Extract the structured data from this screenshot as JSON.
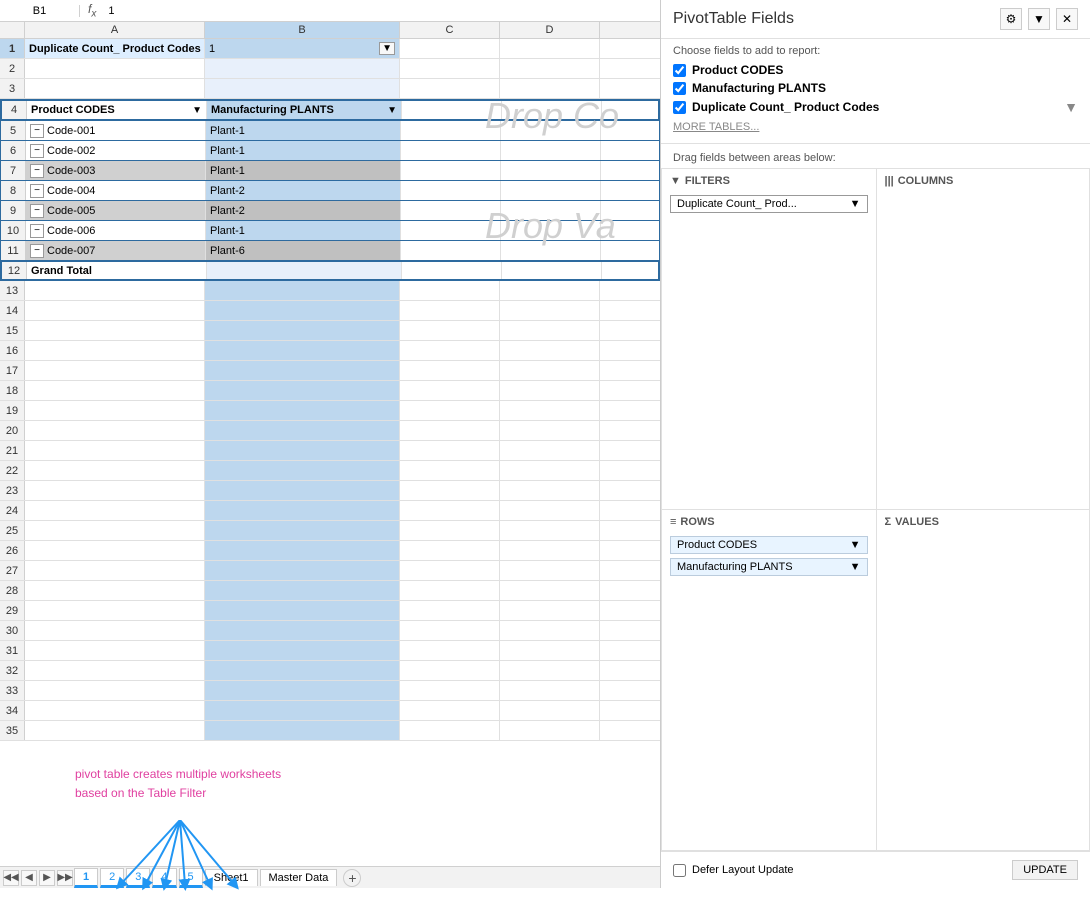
{
  "panel": {
    "title": "PivotTable Fields",
    "chooser_label": "Choose fields to add to report:",
    "fields": [
      {
        "name": "Product CODES",
        "checked": true
      },
      {
        "name": "Manufacturing PLANTS",
        "checked": true
      },
      {
        "name": "Duplicate Count_ Product Codes",
        "checked": true
      }
    ],
    "more_tables": "MORE TABLES...",
    "drag_label": "Drag fields between areas below:",
    "areas": {
      "filters": "FILTERS",
      "columns": "COLUMNS",
      "rows": "ROWS",
      "values": "VALUES"
    },
    "filter_pill": "Duplicate Count_ Prod...",
    "rows_pills": [
      "Product CODES",
      "Manufacturing PLANTS"
    ],
    "defer_label": "Defer Layout Update",
    "update_btn": "UPDATE"
  },
  "spreadsheet": {
    "name_box": "B1",
    "formula": "1",
    "columns": [
      "A",
      "B",
      "C",
      "D"
    ],
    "rows": [
      {
        "num": 1,
        "a": "Duplicate Count_ Product Codes",
        "b": "1",
        "c": "",
        "d": "",
        "filter": true
      },
      {
        "num": 2,
        "a": "",
        "b": "",
        "c": "",
        "d": ""
      },
      {
        "num": 3,
        "a": "",
        "b": "",
        "c": "",
        "d": ""
      },
      {
        "num": 4,
        "a": "Product CODES",
        "b": "Manufacturing PLANTS",
        "c": "",
        "d": "",
        "header": true
      },
      {
        "num": 5,
        "a": "Code-001",
        "b": "Plant-1",
        "c": "",
        "d": "",
        "gray": false
      },
      {
        "num": 6,
        "a": "Code-002",
        "b": "Plant-1",
        "c": "",
        "d": "",
        "gray": false
      },
      {
        "num": 7,
        "a": "Code-003",
        "b": "Plant-1",
        "c": "",
        "d": "",
        "gray": true
      },
      {
        "num": 8,
        "a": "Code-004",
        "b": "Plant-2",
        "c": "",
        "d": "",
        "gray": false
      },
      {
        "num": 9,
        "a": "Code-005",
        "b": "Plant-2",
        "c": "",
        "d": "",
        "gray": true
      },
      {
        "num": 10,
        "a": "Code-006",
        "b": "Plant-1",
        "c": "",
        "d": "",
        "gray": false
      },
      {
        "num": 11,
        "a": "Code-007",
        "b": "Plant-6",
        "c": "",
        "d": "",
        "gray": true
      },
      {
        "num": 12,
        "a": "Grand Total",
        "b": "",
        "c": "",
        "d": ""
      },
      {
        "num": 13,
        "a": "",
        "b": "",
        "c": "",
        "d": ""
      },
      {
        "num": 14,
        "a": "",
        "b": "",
        "c": "",
        "d": ""
      },
      {
        "num": 15,
        "a": "",
        "b": "",
        "c": "",
        "d": ""
      },
      {
        "num": 16,
        "a": "",
        "b": "",
        "c": "",
        "d": ""
      },
      {
        "num": 17,
        "a": "",
        "b": "",
        "c": "",
        "d": ""
      },
      {
        "num": 18,
        "a": "",
        "b": "",
        "c": "",
        "d": ""
      },
      {
        "num": 19,
        "a": "",
        "b": "",
        "c": "",
        "d": ""
      },
      {
        "num": 20,
        "a": "",
        "b": "",
        "c": "",
        "d": ""
      },
      {
        "num": 21,
        "a": "",
        "b": "",
        "c": "",
        "d": ""
      },
      {
        "num": 22,
        "a": "",
        "b": "",
        "c": "",
        "d": ""
      },
      {
        "num": 23,
        "a": "",
        "b": "",
        "c": "",
        "d": ""
      },
      {
        "num": 24,
        "a": "",
        "b": "",
        "c": "",
        "d": ""
      },
      {
        "num": 25,
        "a": "",
        "b": "",
        "c": "",
        "d": ""
      },
      {
        "num": 26,
        "a": "",
        "b": "",
        "c": "",
        "d": ""
      },
      {
        "num": 27,
        "a": "",
        "b": "",
        "c": "",
        "d": ""
      },
      {
        "num": 28,
        "a": "",
        "b": "",
        "c": "",
        "d": ""
      },
      {
        "num": 29,
        "a": "",
        "b": "",
        "c": "",
        "d": ""
      },
      {
        "num": 30,
        "a": "",
        "b": "",
        "c": "",
        "d": ""
      },
      {
        "num": 31,
        "a": "",
        "b": "",
        "c": "",
        "d": ""
      },
      {
        "num": 32,
        "a": "",
        "b": "",
        "c": "",
        "d": ""
      },
      {
        "num": 33,
        "a": "",
        "b": "",
        "c": "",
        "d": ""
      },
      {
        "num": 34,
        "a": "",
        "b": "",
        "c": "",
        "d": ""
      },
      {
        "num": 35,
        "a": "",
        "b": "",
        "c": "",
        "d": ""
      }
    ],
    "annotation": "pivot table creates multiple worksheets\nbased on the Table Filter",
    "tabs": [
      "1",
      "2",
      "3",
      "4",
      "5",
      "Sheet1",
      "Master Data"
    ],
    "active_tab": "1"
  }
}
